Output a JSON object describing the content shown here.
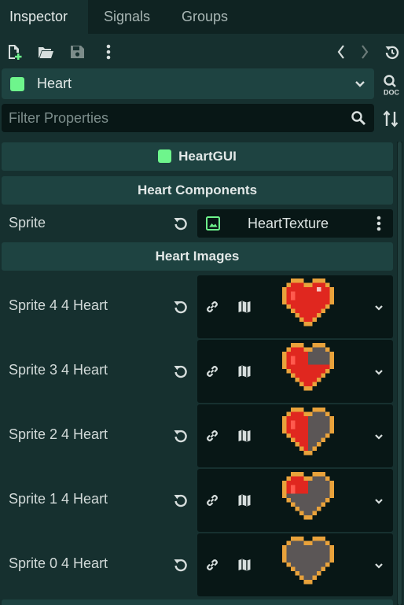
{
  "tabs": [
    {
      "label": "Inspector",
      "active": true
    },
    {
      "label": "Signals",
      "active": false
    },
    {
      "label": "Groups",
      "active": false
    }
  ],
  "toolbar": {
    "icons": [
      "new-resource-icon",
      "open-folder-icon",
      "save-icon",
      "more-icon",
      "history-back-icon",
      "history-forward-icon",
      "object-history-icon"
    ]
  },
  "node": {
    "name": "Heart",
    "color": "#6ef58c"
  },
  "doc_button": {
    "label": "DOC"
  },
  "filter": {
    "placeholder": "Filter Properties",
    "value": ""
  },
  "sections": {
    "class_header": "HeartGUI",
    "group1": "Heart Components",
    "group2": "Heart Images"
  },
  "sprite_property": {
    "label": "Sprite",
    "resource": "HeartTexture"
  },
  "heart_images": [
    {
      "label": "Sprite 4 4 Heart",
      "filled_quarters": 4
    },
    {
      "label": "Sprite 3 4 Heart",
      "filled_quarters": 3
    },
    {
      "label": "Sprite 2 4 Heart",
      "filled_quarters": 2
    },
    {
      "label": "Sprite 1 4 Heart",
      "filled_quarters": 1
    },
    {
      "label": "Sprite 0 4 Heart",
      "filled_quarters": 0
    }
  ],
  "colors": {
    "accent_green": "#6ef58c",
    "heart_red": "#e0271f",
    "heart_empty": "#5b5656",
    "heart_border": "#e9a23b"
  }
}
